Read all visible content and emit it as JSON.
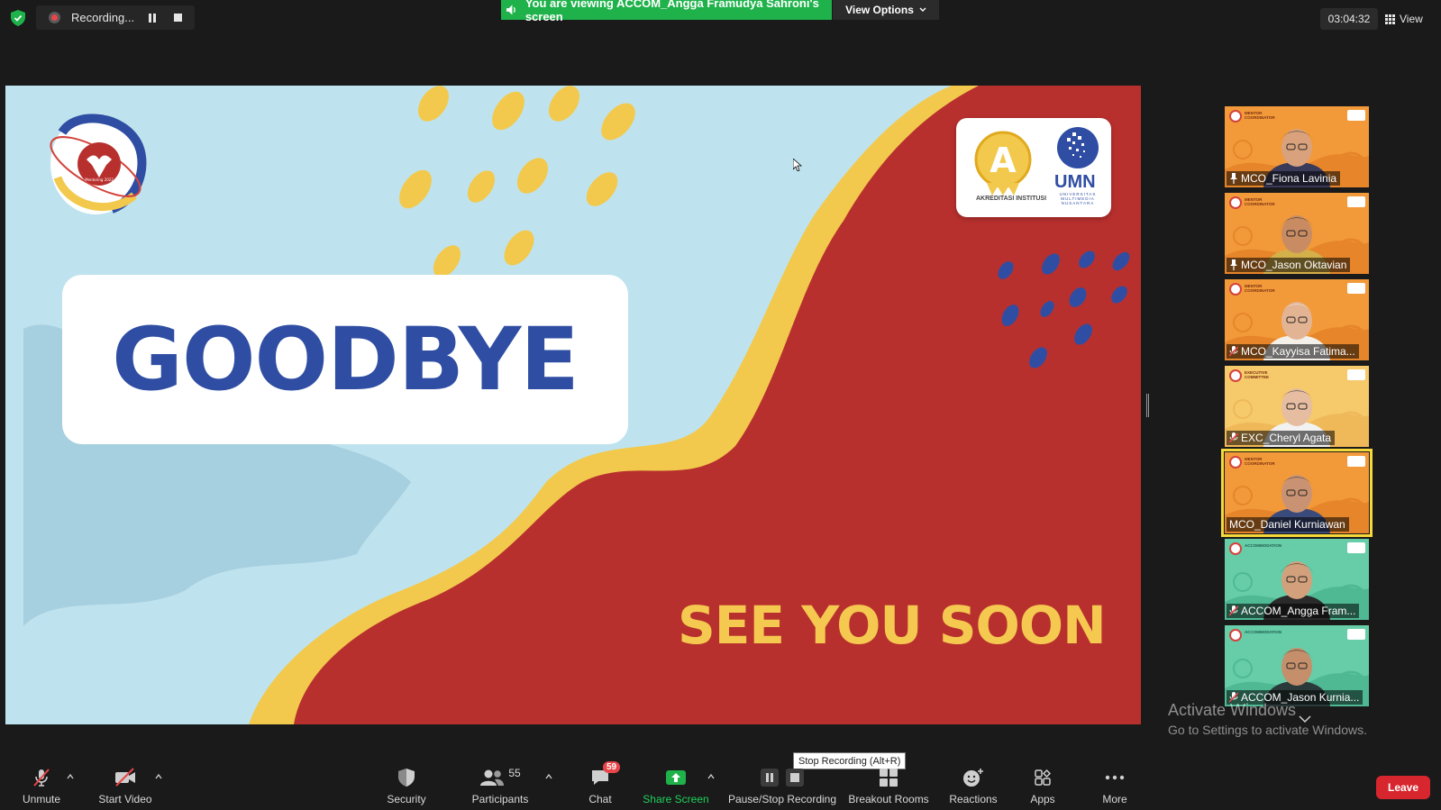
{
  "recording": {
    "label": "Recording..."
  },
  "banner": {
    "viewing_text": "You are viewing ACCOM_Angga Framudya Sahroni's screen",
    "view_options": "View Options"
  },
  "timer": "03:04:32",
  "view_label": "View",
  "slide": {
    "title": "GOODBYE",
    "subtitle": "SEE YOU SOON",
    "logo_accreditation": "AKREDITASI INSTITUSI",
    "logo_a": "A",
    "logo_umn": "UMN",
    "logo_umn_sub": "UNIVERSITAS MULTIMEDIA NUSANTARA",
    "mentoring_logo_text": "Mentoring 2022"
  },
  "participants": [
    {
      "name": "MCO_Fiona Lavinia",
      "role": "MENTOR COORDINATOR",
      "theme": "orange",
      "mic": "pinned"
    },
    {
      "name": "MCO_Jason Oktavian",
      "role": "MENTOR COORDINATOR",
      "theme": "orange",
      "mic": "pinned"
    },
    {
      "name": "MCO_Kayyisa Fatima...",
      "role": "MENTOR COORDINATOR",
      "theme": "orange",
      "mic": "muted"
    },
    {
      "name": "EXC_Cheryl Agata",
      "role": "EXECUTIVE COMMITTEE",
      "theme": "yellowish",
      "mic": "muted"
    },
    {
      "name": "MCO_Daniel Kurniawan",
      "role": "MENTOR COORDINATOR",
      "theme": "orange",
      "mic": "active"
    },
    {
      "name": "ACCOM_Angga Fram...",
      "role": "ACCOMMODATION",
      "theme": "green",
      "mic": "muted"
    },
    {
      "name": "ACCOM_Jason Kurnia...",
      "role": "ACCOMMODATION",
      "theme": "green",
      "mic": "muted"
    }
  ],
  "windows_watermark": {
    "line1": "Activate Windows",
    "line2": "Go to Settings to activate Windows."
  },
  "tooltip": "Stop Recording (Alt+R)",
  "toolbar": {
    "unmute": "Unmute",
    "start_video": "Start Video",
    "security": "Security",
    "participants": "Participants",
    "participants_count": "55",
    "chat": "Chat",
    "chat_badge": "59",
    "share_screen": "Share Screen",
    "pause_stop_recording": "Pause/Stop Recording",
    "breakout_rooms": "Breakout Rooms",
    "reactions": "Reactions",
    "apps": "Apps",
    "more": "More",
    "leave": "Leave"
  },
  "colors": {
    "share_green": "#1fb24b",
    "leave_red": "#d7262e",
    "slide_blue": "#2f4ea3",
    "slide_red": "#b8302e",
    "slide_yellow": "#f5c94f",
    "slide_light": "#bfe3ee"
  }
}
